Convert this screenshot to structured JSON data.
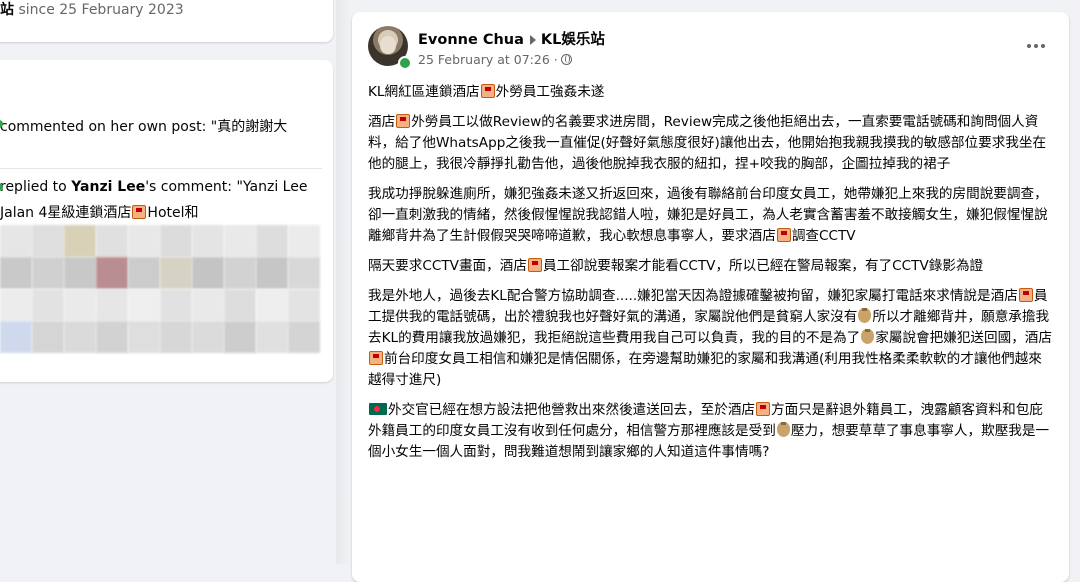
{
  "left": {
    "since_name": "站",
    "since_text": "since 25 February 2023",
    "activity1": {
      "text": "commented on her own post: \"真的謝謝大"
    },
    "activity2": {
      "prefix": "replied to ",
      "name": "Yanzi Lee",
      "suffix": "'s comment: \"Yanzi Lee",
      "line2": "Jalan        4星級連鎖酒店",
      "line2_tail": "Hotel和"
    }
  },
  "post": {
    "author": "Evonne Chua",
    "group": "KL娛乐站",
    "timestamp": "25 February at 07:26 ·",
    "more_icon": "more-options-icon",
    "title_a": "KL網紅區連鎖酒店",
    "title_b": "外勞員工強姦未遂",
    "p1_a": "酒店",
    "p1_b": "外勞員工以做Review的名義要求进房間，Review完成之後他拒絕出去，一直索要電話號碼和詢問個人資料，給了他WhatsApp之後我一直催促(好聲好氣態度很好)讓他出去，他開始抱我親我摸我的敏感部位要求我坐在他的腿上，我很冷靜掙扎勸告他，過後他脫掉我衣服的紐扣，捏+咬我的胸部，企圖拉掉我的裙子",
    "p2_a": "我成功掙脫躲進廁所，嫌犯強姦未遂又折返回來，過後有聯絡前台印度女員工，她帶嫌犯上來我的房間說要調查，卻一直刺激我的情緒，然後假惺惺說我認錯人啦，嫌犯是好員工，為人老實含蓄害羞不敢接觸女生，嫌犯假惺惺說離鄉背井為了生計假假哭哭啼啼道歉，我心軟想息事寧人，要求酒店",
    "p2_b": "調查CCTV",
    "p3_a": "隔天要求CCTV畫面，酒店",
    "p3_b": "員工卻說要報案才能看CCTV，所以已經在警局報案，有了CCTV錄影為證",
    "p4_a": "我是外地人，過後去KL配合警方協助調查.....嫌犯當天因為證據確鑿被拘留，嫌犯家屬打電話來求情說是酒店",
    "p4_b": "員工提供我的電話號碼，出於禮貌我也好聲好氣的溝通，家屬說他們是貧窮人家沒有",
    "p4_c": "所以才離鄉背井，願意承擔我去KL的費用讓我放過嫌犯，我拒絕說這些費用我自己可以負責，我的目的不是為了",
    "p4_d": "家屬說會把嫌犯送回國，酒店",
    "p4_e": "前台印度女員工相信和嫌犯是情侶關係，在旁邊幫助嫌犯的家屬和我溝通(利用我性格柔柔軟軟的才讓他們越來越得寸進尺)",
    "p5_a": "外交官已經在想方設法把他營救出來然後遣送回去，至於酒店",
    "p5_b": "方面只是辭退外籍員工，洩露顧客資料和包庇外籍員工的印度女員工沒有收到任何處分，相信警方那裡應該是受到",
    "p5_c": "壓力，想要草草了事息事寧人，欺壓我是一個小女生一個人面對，問我難道想鬧到讓家鄉的人知道這件事情嗎?"
  },
  "colors": {
    "page_bg": "#f0f2f5",
    "card_bg": "#ffffff",
    "text": "#050505",
    "secondary": "#65676b",
    "online": "#31a24c"
  }
}
